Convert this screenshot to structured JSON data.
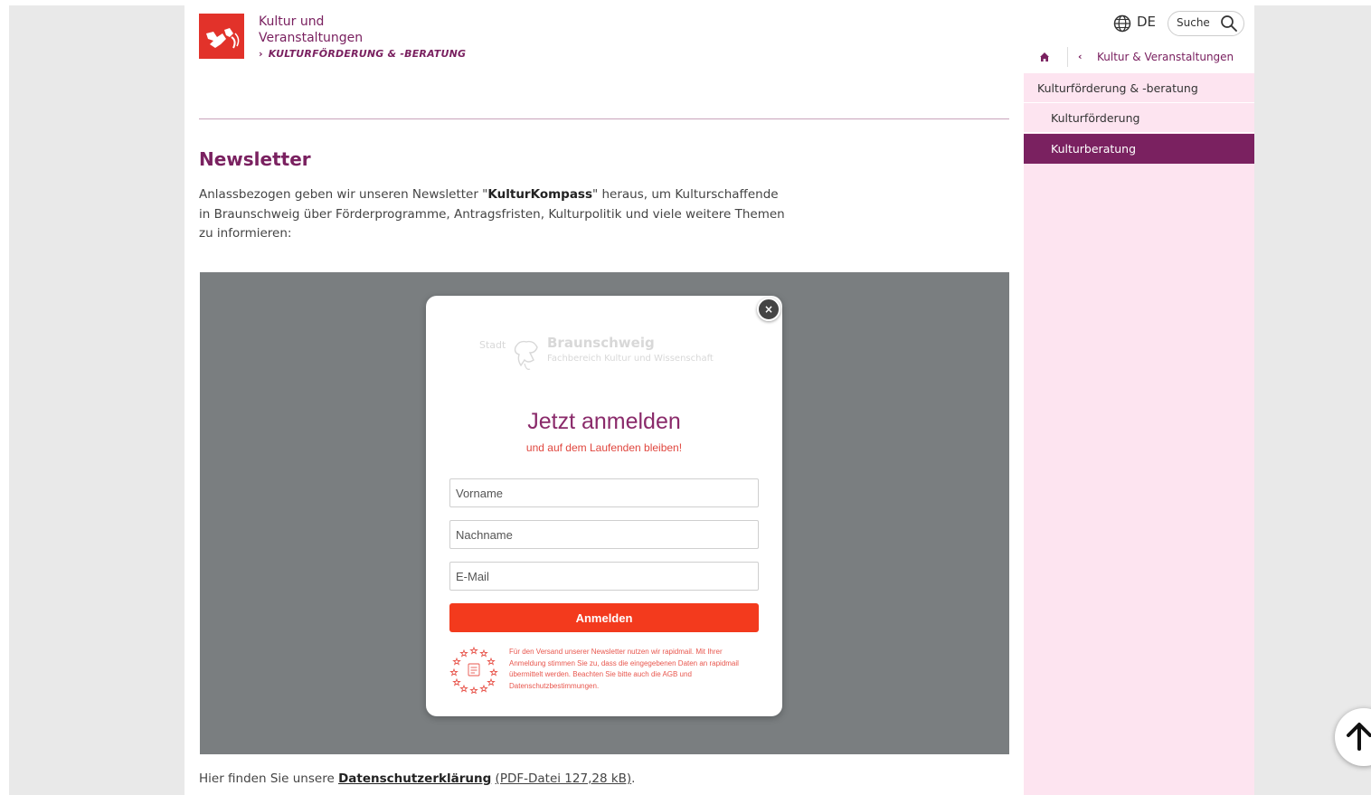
{
  "header": {
    "site_title_line1": "Kultur und",
    "site_title_line2": "Veranstaltungen",
    "breadcrumb": "KULTURFÖRDERUNG & -BERATUNG"
  },
  "topbar": {
    "language": "DE",
    "search_label": "Suche"
  },
  "nav": {
    "back_link": "Kultur & Veranstaltungen",
    "items": [
      {
        "label": "Kulturförderung & -beratung"
      },
      {
        "label": "Kulturförderung"
      },
      {
        "label": "Kulturberatung",
        "active": true
      }
    ]
  },
  "main": {
    "heading": "Newsletter",
    "intro_before": "Anlassbezogen geben wir unseren Newsletter \"",
    "intro_bold": "KulturKompass",
    "intro_after": "\" heraus, um Kulturschaffende in Braunschweig über Förderprogramme, Antragsfristen, Kulturpolitik und viele weitere Themen zu informieren:",
    "privacy_prefix": "Hier finden Sie unsere ",
    "privacy_link": "Datenschutzerklärung",
    "privacy_file": "(PDF-Datei 127,28 kB)",
    "privacy_suffix": "."
  },
  "signup": {
    "logo_stadt": "Stadt",
    "logo_name": "Braunschweig",
    "logo_dept": "Fachbereich Kultur und Wissenschaft",
    "title": "Jetzt anmelden",
    "subtitle": "und auf dem Laufenden bleiben!",
    "first_name_placeholder": "Vorname",
    "last_name_placeholder": "Nachname",
    "email_placeholder": "E-Mail",
    "submit_label": "Anmelden",
    "legal_text": "Für den Versand unserer Newsletter nutzen wir rapidmail. Mit Ihrer Anmeldung stimmen Sie zu, dass die eingegebenen Daten an rapidmail übermittelt werden. Beachten Sie bitte auch die AGB und Datenschutzbestimmungen.",
    "close_label": "×"
  },
  "colors": {
    "brand": "#7a2160",
    "logo_red": "#e2322a",
    "submit": "#f33a1d",
    "menu_bg": "#fde4f0"
  },
  "icons": {
    "language": "globe-icon",
    "search": "search-icon",
    "home": "home-icon",
    "scroll_top": "arrow-up-icon"
  }
}
